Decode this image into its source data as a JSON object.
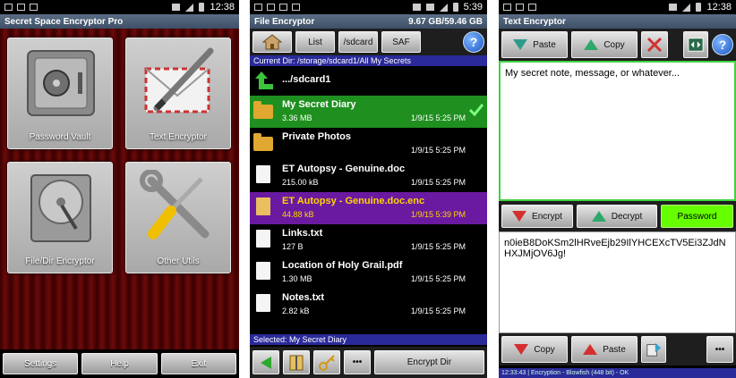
{
  "screen1": {
    "status_time": "12:38",
    "title": "Secret Space Encryptor Pro",
    "tiles": [
      {
        "label": "Password Vault"
      },
      {
        "label": "Text Encryptor"
      },
      {
        "label": "File/Dir Encryptor"
      },
      {
        "label": "Other Utils"
      }
    ],
    "bottom": {
      "settings": "Settings",
      "help": "Help",
      "exit": "Exit"
    }
  },
  "screen2": {
    "status_time": "5:39",
    "title": "File Encryptor",
    "storage": "9.67 GB/59.46 GB",
    "toolbar": {
      "list": "List",
      "sdcard": "/sdcard",
      "saf": "SAF",
      "help": "?"
    },
    "current_dir": "Current Dir: /storage/sdcard1/All My Secrets",
    "up_label": ".../sdcard1",
    "files": [
      {
        "name": "My Secret Diary",
        "size": "3.36 MB",
        "date": "1/9/15 5:25 PM",
        "kind": "folder",
        "state": "selected"
      },
      {
        "name": "Private Photos",
        "size": "",
        "date": "1/9/15 5:25 PM",
        "kind": "folder",
        "state": "normal"
      },
      {
        "name": "ET Autopsy - Genuine.doc",
        "size": "215.00 kB",
        "date": "1/9/15 5:25 PM",
        "kind": "doc",
        "state": "normal"
      },
      {
        "name": "ET Autopsy - Genuine.doc.enc",
        "size": "44.88 kB",
        "date": "1/9/15 5:39 PM",
        "kind": "enc",
        "state": "encrypted"
      },
      {
        "name": "Links.txt",
        "size": "127 B",
        "date": "1/9/15 5:25 PM",
        "kind": "doc",
        "state": "normal"
      },
      {
        "name": "Location of Holy Grail.pdf",
        "size": "1.30 MB",
        "date": "1/9/15 5:25 PM",
        "kind": "doc",
        "state": "normal"
      },
      {
        "name": "Notes.txt",
        "size": "2.82 kB",
        "date": "1/9/15 5:25 PM",
        "kind": "doc",
        "state": "normal"
      }
    ],
    "selected": "Selected: My Secret Diary",
    "bottom": {
      "more": "•••",
      "encrypt_dir": "Encrypt Dir"
    }
  },
  "screen3": {
    "status_time": "12:38",
    "title": "Text Encryptor",
    "toolbar": {
      "paste": "Paste",
      "copy": "Copy"
    },
    "plaintext": "My secret note, message, or whatever...",
    "mid": {
      "encrypt": "Encrypt",
      "decrypt": "Decrypt",
      "password": "Password"
    },
    "ciphertext": "n0ieB8DoKSm2lHRveEjb29IlYHCEXcTV5Ei3ZJdNHXJMjOV6Jg!",
    "bottom": {
      "copy": "Copy",
      "paste": "Paste",
      "more": "•••"
    },
    "statusline": "12:33:43 | Encryption - Blowfish (448 bit) - OK"
  }
}
